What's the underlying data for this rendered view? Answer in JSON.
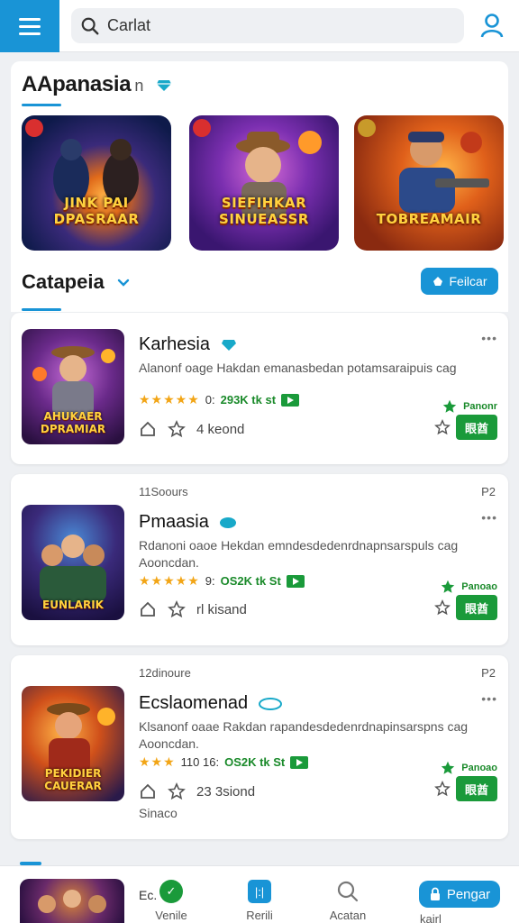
{
  "topbar": {
    "search_placeholder": "Carlat"
  },
  "featured": {
    "title": "AApanasia",
    "title_suffix": "n",
    "thumbnails": [
      {
        "caption": "JINK PAI DPASRAAR"
      },
      {
        "caption": "SIEFIHKAR SINUEASSR"
      },
      {
        "caption": "TOBREAMAIR"
      }
    ]
  },
  "category": {
    "title": "Catapeia",
    "follow_label": "Feilcar"
  },
  "cards": [
    {
      "time": "",
      "page": "",
      "name": "Karhesia",
      "description": "Alanonf oage Hakdan emanasbedan potamsaraipuis cag",
      "description2": "",
      "rating_num": "0:",
      "stat": "293K tk st",
      "meta": "4 keond",
      "rank": "Panonr",
      "get_label": "眼酋",
      "extra": "",
      "cover_caption": "AHUKAER DPRAMIAR"
    },
    {
      "time": "11Soours",
      "page": "P2",
      "name": "Pmaasia",
      "description": "Rdanoni oaoe Hekdan emndesdedenrdnapnsarspuls cag",
      "description2": "Aooncdan.",
      "rating_num": "9:",
      "stat": "OS2K tk St",
      "meta": "rl kisand",
      "rank": "Panoao",
      "get_label": "眼酋",
      "extra": "",
      "cover_caption": "EUNLARIK"
    },
    {
      "time": "12dinoure",
      "page": "P2",
      "name": "Ecslaomenad",
      "description": "Klsanonf oaae Rakdan rapandesdedenrdnapinsarspns cag",
      "description2": "Aooncdan.",
      "rating_num": "110 16:",
      "stat": "OS2K tk St",
      "meta": "23 3siond",
      "rank": "Panoao",
      "get_label": "眼酋",
      "extra": "Sinaco",
      "cover_caption": "PEKIDIER CAUERAR"
    }
  ],
  "bottomnav": {
    "dot_label": "Ec.",
    "items": [
      {
        "label": "Venile"
      },
      {
        "label": "Rerili"
      },
      {
        "label": "Acatan"
      }
    ],
    "cta_label": "Pengar",
    "cta_sub": "kairl"
  }
}
